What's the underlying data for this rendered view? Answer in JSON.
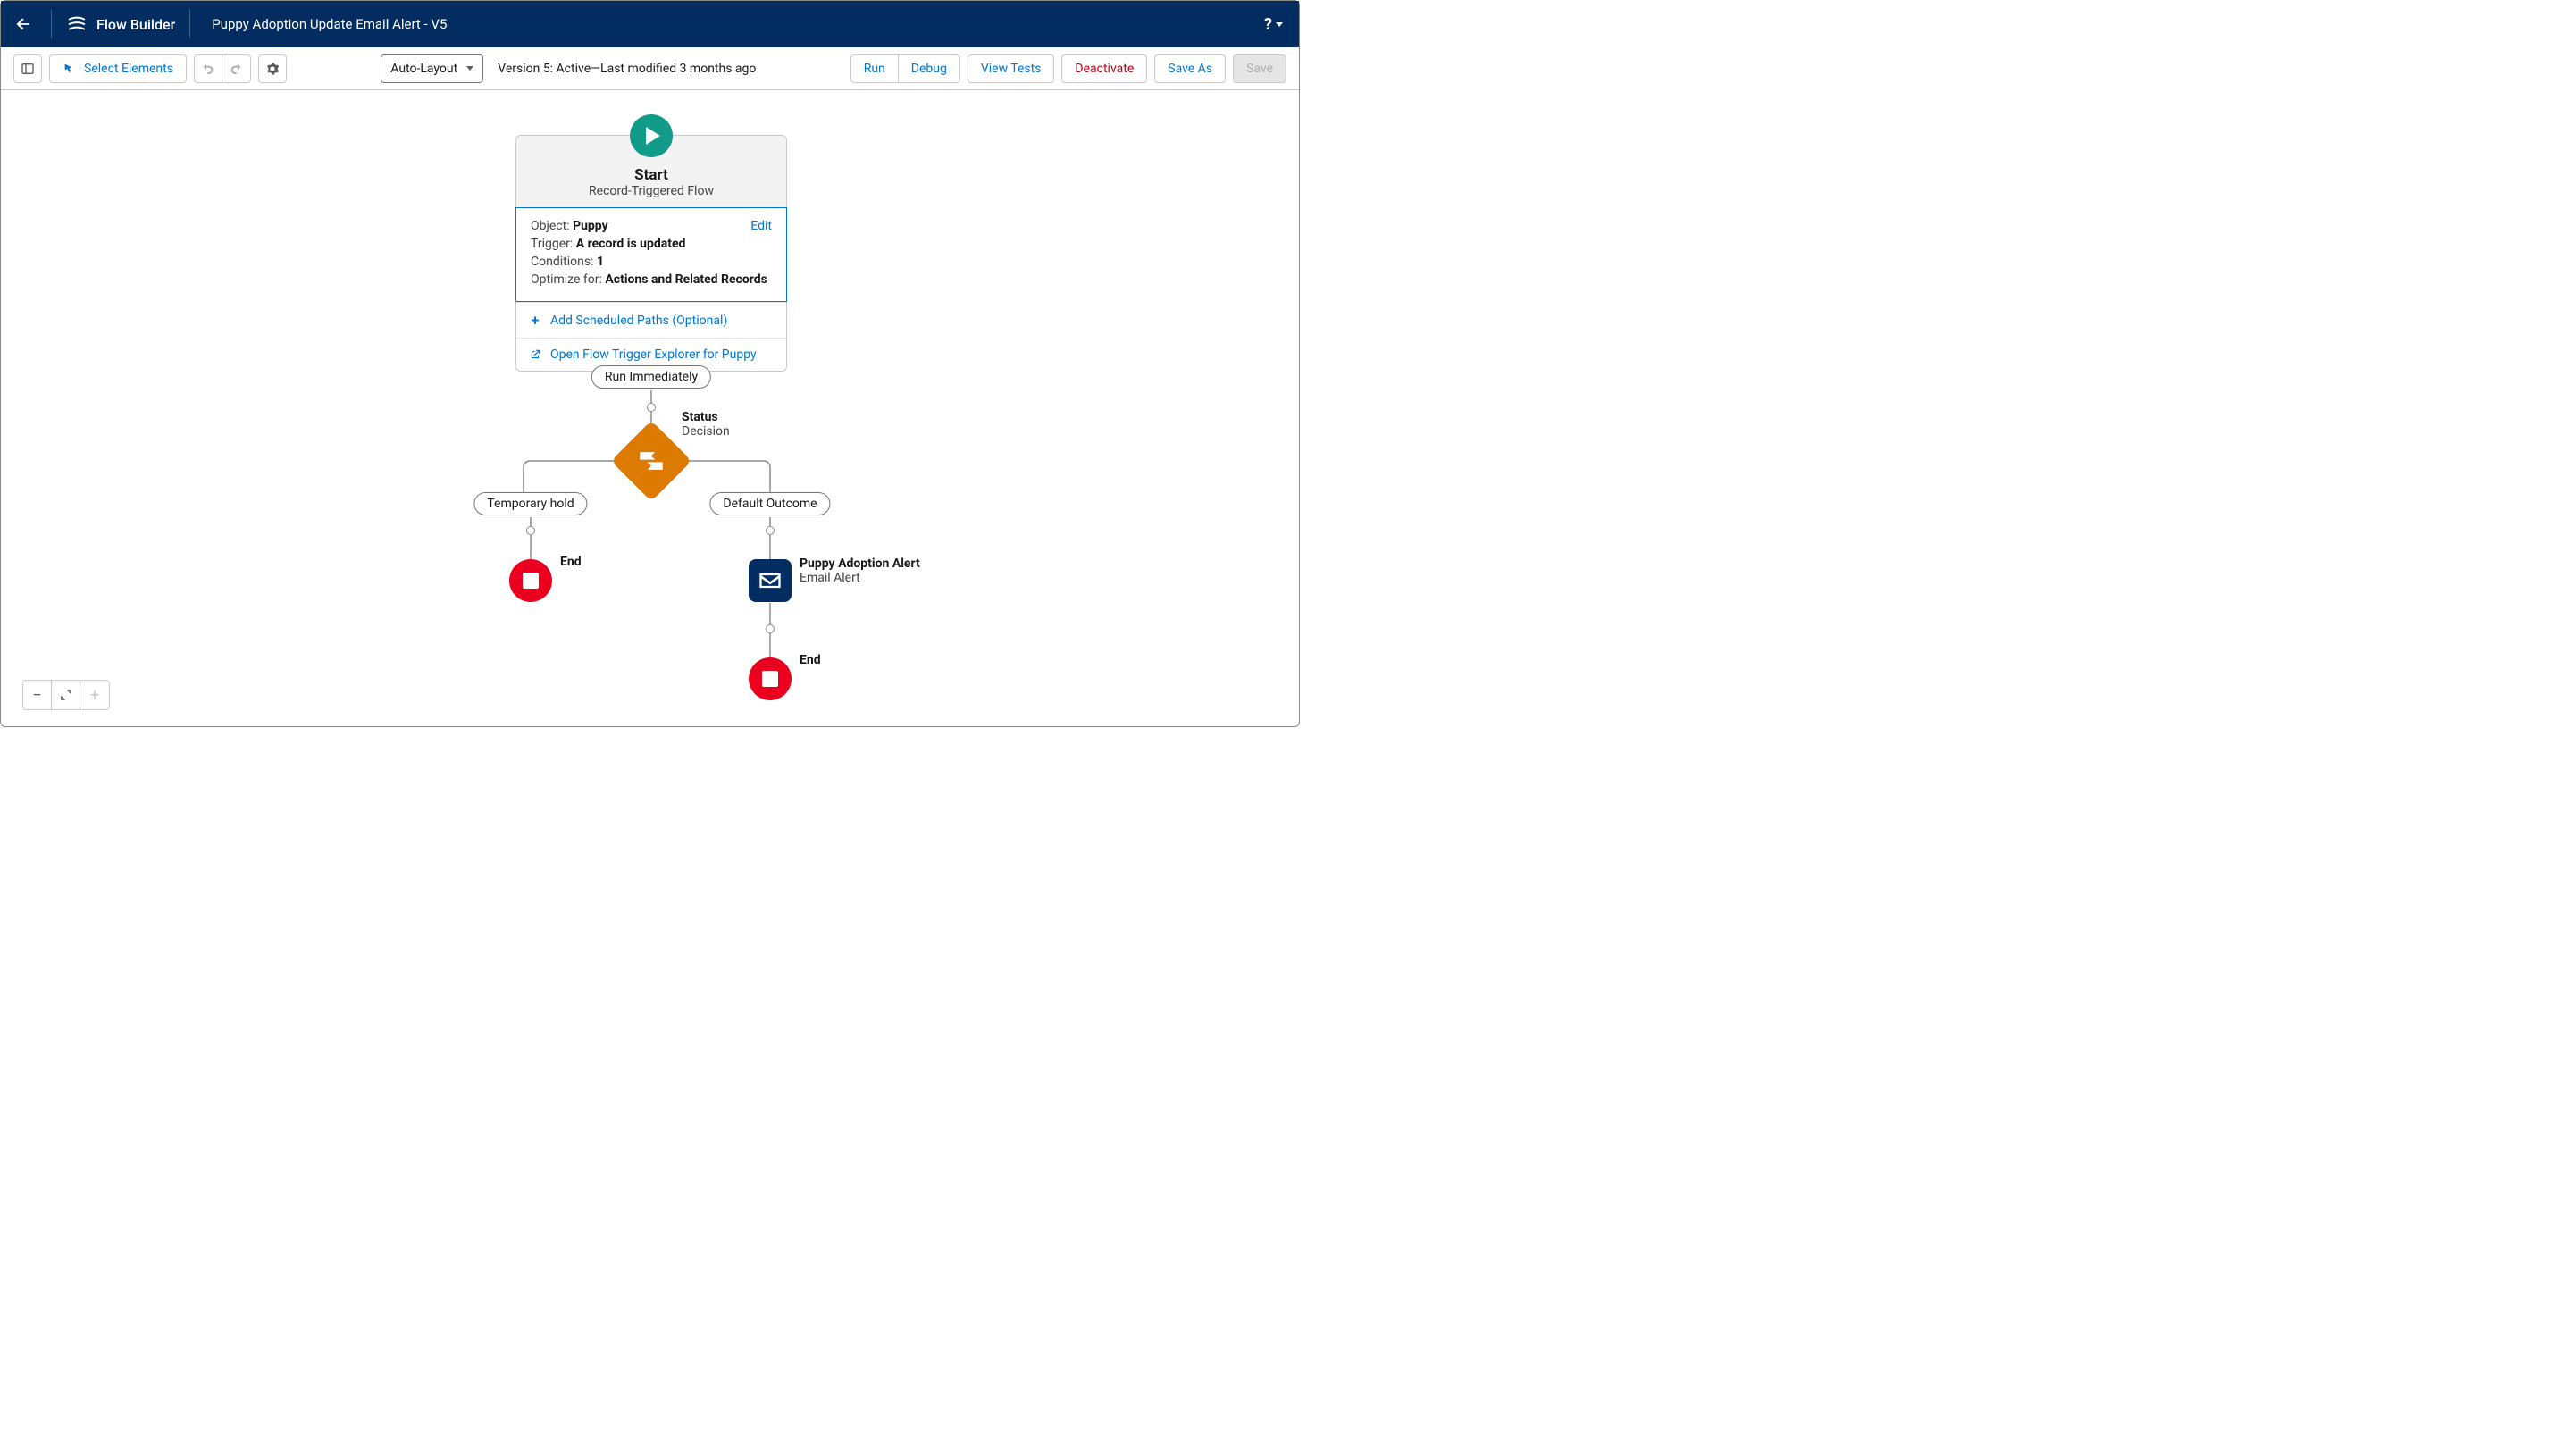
{
  "header": {
    "app_title": "Flow Builder",
    "flow_name": "Puppy Adoption Update Email Alert - V5",
    "help_label": "?"
  },
  "toolbar": {
    "select_elements": "Select Elements",
    "layout_mode": "Auto-Layout",
    "status_text": "Version 5: Active—Last modified 3 months ago",
    "run": "Run",
    "debug": "Debug",
    "view_tests": "View Tests",
    "deactivate": "Deactivate",
    "save_as": "Save As",
    "save": "Save"
  },
  "start": {
    "title": "Start",
    "subtitle": "Record-Triggered Flow",
    "edit": "Edit",
    "object_k": "Object:",
    "object_v": "Puppy",
    "trigger_k": "Trigger:",
    "trigger_v": "A record is updated",
    "conditions_k": "Conditions:",
    "conditions_v": "1",
    "optimize_k": "Optimize for:",
    "optimize_v": "Actions and Related Records",
    "add_scheduled": "Add Scheduled Paths (Optional)",
    "open_explorer": "Open Flow Trigger Explorer for Puppy"
  },
  "path": {
    "run_immediately": "Run Immediately",
    "decision_name": "Status",
    "decision_type": "Decision",
    "outcome_left": "Temporary hold",
    "outcome_right": "Default Outcome",
    "end_left": "End",
    "action_name": "Puppy Adoption Alert",
    "action_type": "Email Alert",
    "end_right": "End"
  }
}
